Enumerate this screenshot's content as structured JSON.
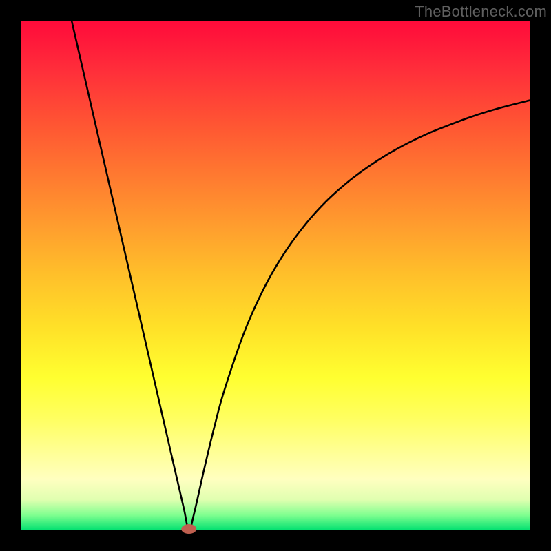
{
  "attribution": "TheBottleneck.com",
  "colors": {
    "background": "#000000",
    "gradient_top": "#ff0a3a",
    "gradient_bottom": "#00e070",
    "curve": "#000000",
    "marker_fill": "#c06050",
    "marker_stroke": "#a04038"
  },
  "chart_data": {
    "type": "line",
    "title": "",
    "xlabel": "",
    "ylabel": "",
    "xlim": [
      0,
      100
    ],
    "ylim": [
      0,
      100
    ],
    "x": [
      10,
      12,
      14,
      16,
      18,
      20,
      22,
      24,
      26,
      28,
      30,
      32,
      33,
      34,
      36,
      38,
      40,
      44,
      48,
      52,
      56,
      60,
      64,
      68,
      72,
      76,
      80,
      84,
      88,
      92,
      96,
      100
    ],
    "y": [
      100,
      91.3,
      82.6,
      73.9,
      65.2,
      56.5,
      47.8,
      39.1,
      30.4,
      21.7,
      13.0,
      4.35,
      0,
      3.2,
      12.0,
      20.3,
      27.6,
      39.2,
      48.0,
      54.8,
      60.2,
      64.6,
      68.2,
      71.2,
      73.8,
      76.0,
      77.9,
      79.5,
      81.0,
      82.3,
      83.4,
      84.4
    ],
    "marker": {
      "x": 33,
      "y": 0,
      "shape": "ellipse"
    },
    "annotations": []
  }
}
